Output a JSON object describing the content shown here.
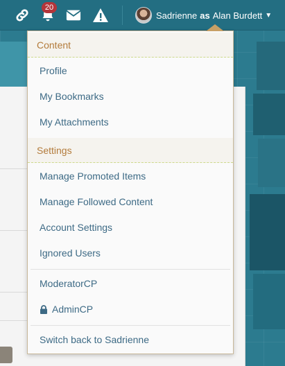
{
  "topbar": {
    "notification_count": "20",
    "icons": [
      "link-icon",
      "bell-icon",
      "envelope-icon",
      "warning-icon"
    ],
    "user": {
      "name": "Sadrienne",
      "as_label": "as",
      "impersonated": "Alan Burdett"
    }
  },
  "menu": {
    "content_heading": "Content",
    "content_items": [
      "Profile",
      "My Bookmarks",
      "My Attachments"
    ],
    "settings_heading": "Settings",
    "settings_items": [
      "Manage Promoted Items",
      "Manage Followed Content",
      "Account Settings",
      "Ignored Users"
    ],
    "moderator": "ModeratorCP",
    "admin": "AdminCP",
    "switch_back": "Switch back to Sadrienne"
  },
  "colors": {
    "topbar": "#236e82",
    "badge": "#b3353a",
    "heading_text": "#b37b3b",
    "link_text": "#3d6a85"
  }
}
